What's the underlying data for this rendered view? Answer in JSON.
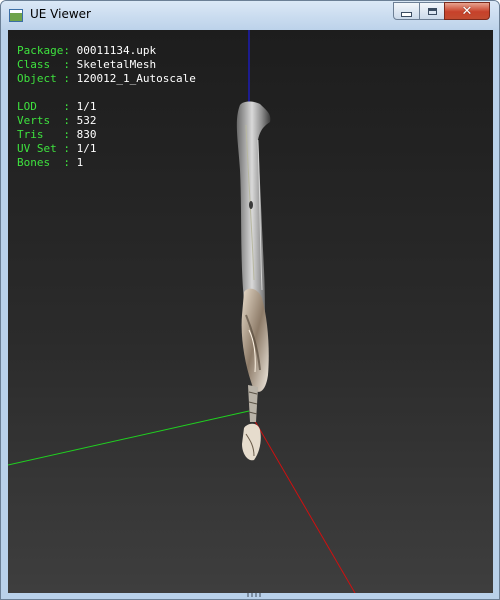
{
  "window": {
    "title": "UE Viewer",
    "icon": "app-window-icon",
    "controls": {
      "minimize_icon": "minimize-icon",
      "maximize_icon": "maximize-icon",
      "close_icon": "close-icon"
    }
  },
  "info": {
    "package": {
      "label": "Package:",
      "value": "00011134.upk"
    },
    "class": {
      "label": "Class  :",
      "value": "SkeletalMesh"
    },
    "object": {
      "label": "Object :",
      "value": "120012_1_Autoscale"
    },
    "lod": {
      "label": "LOD    :",
      "value": "1/1"
    },
    "verts": {
      "label": "Verts  :",
      "value": "532"
    },
    "tris": {
      "label": "Tris   :",
      "value": "830"
    },
    "uvset": {
      "label": "UV Set :",
      "value": "1/1"
    },
    "bones": {
      "label": "Bones  :",
      "value": "1"
    }
  },
  "colors": {
    "label_text": "#3ee23e",
    "value_text": "#ffffff",
    "axis_x": "#d01010",
    "axis_y": "#20d020",
    "axis_z": "#1a1aff"
  }
}
